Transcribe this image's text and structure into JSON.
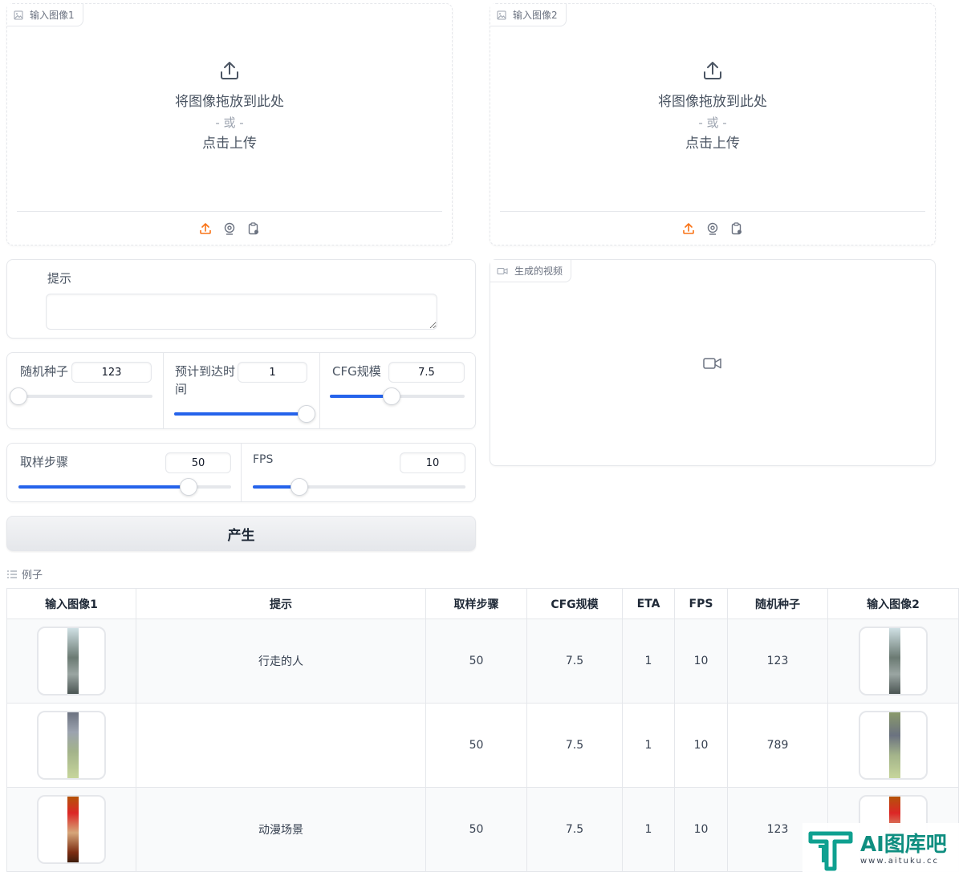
{
  "input1": {
    "label": "输入图像1",
    "drop_text": "将图像拖放到此处",
    "or_text": "- 或 -",
    "click_text": "点击上传"
  },
  "input2": {
    "label": "输入图像2",
    "drop_text": "将图像拖放到此处",
    "or_text": "- 或 -",
    "click_text": "点击上传"
  },
  "prompt": {
    "label": "提示",
    "value": ""
  },
  "video": {
    "label": "生成的视频"
  },
  "sliders": {
    "seed": {
      "label": "随机种子",
      "value": "123",
      "fraction": 0.0
    },
    "eta": {
      "label": "预计到达时间",
      "value": "1",
      "fraction": 1.0
    },
    "cfg": {
      "label": "CFG规模",
      "value": "7.5",
      "fraction": 0.46
    },
    "steps": {
      "label": "取样步骤",
      "value": "50",
      "fraction": 0.8
    },
    "fps": {
      "label": "FPS",
      "value": "10",
      "fraction": 0.22
    }
  },
  "generate_label": "产生",
  "examples": {
    "title": "例子",
    "headers": [
      "输入图像1",
      "提示",
      "取样步骤",
      "CFG规模",
      "ETA",
      "FPS",
      "随机种子",
      "输入图像2"
    ],
    "rows": [
      {
        "prompt": "行走的人",
        "steps": "50",
        "cfg": "7.5",
        "eta": "1",
        "fps": "10",
        "seed": "123"
      },
      {
        "prompt": "",
        "steps": "50",
        "cfg": "7.5",
        "eta": "1",
        "fps": "10",
        "seed": "789"
      },
      {
        "prompt": "动漫场景",
        "steps": "50",
        "cfg": "7.5",
        "eta": "1",
        "fps": "10",
        "seed": "123"
      }
    ]
  },
  "colors": {
    "accent": "#2563eb",
    "upload_active": "#f97316"
  },
  "watermark": {
    "brand": "AI图库吧",
    "url": "www.aituku.cc"
  }
}
